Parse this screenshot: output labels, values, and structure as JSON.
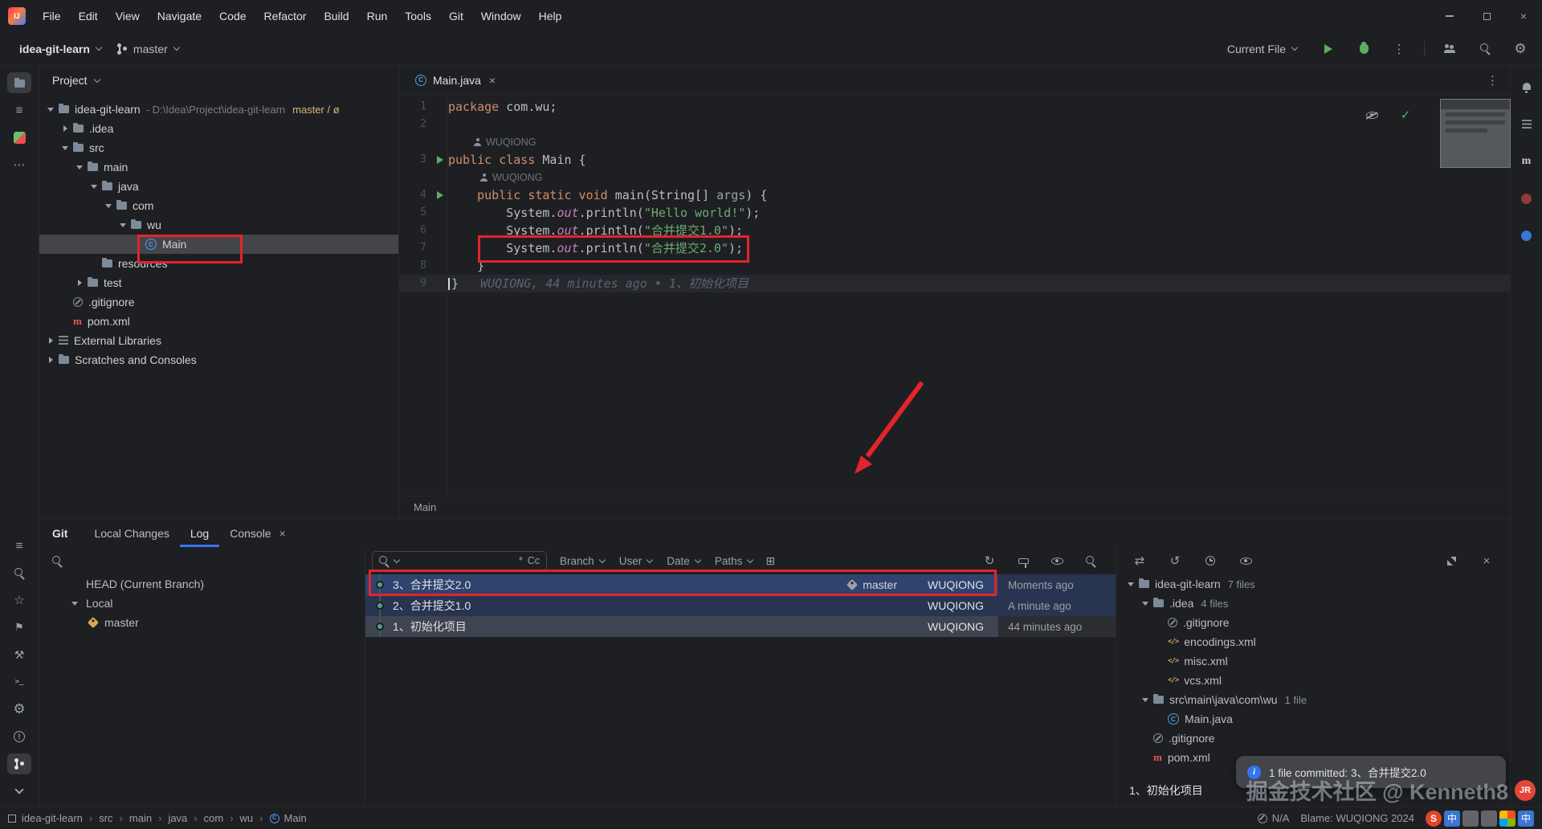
{
  "menu": {
    "items": [
      "File",
      "Edit",
      "View",
      "Navigate",
      "Code",
      "Refactor",
      "Build",
      "Run",
      "Tools",
      "Git",
      "Window",
      "Help"
    ]
  },
  "toolbar": {
    "project": "idea-git-learn",
    "branch": "master",
    "run_config": "Current File",
    "right_icons": [
      {
        "name": "run-button",
        "icon": "play"
      },
      {
        "name": "debug-button",
        "icon": "bug"
      },
      {
        "name": "more-actions-icon",
        "icon": "dotsv"
      },
      {
        "name": "toolbar-divider",
        "icon": "divider"
      },
      {
        "name": "code-with-me-icon",
        "icon": "users"
      },
      {
        "name": "search-everywhere-icon",
        "icon": "search"
      },
      {
        "name": "settings-icon",
        "icon": "gear"
      }
    ]
  },
  "left_strip": {
    "top": [
      {
        "name": "project-tool-icon",
        "icon": "folder",
        "active": true
      },
      {
        "name": "structure-tool-icon",
        "icon": "commit"
      },
      {
        "name": "plugin-tool-icon",
        "icon": "plugin"
      },
      {
        "name": "more-tool-windows-icon",
        "icon": "dotsh"
      }
    ],
    "bottom": [
      {
        "name": "commit-graph-icon",
        "icon": "commit"
      },
      {
        "name": "find-tool-icon",
        "icon": "search"
      },
      {
        "name": "favorites-icon",
        "icon": "star"
      },
      {
        "name": "bookmarks-icon",
        "icon": "flag"
      },
      {
        "name": "build-tool-icon",
        "icon": "build"
      },
      {
        "name": "terminal-tool-icon",
        "icon": "terminal"
      },
      {
        "name": "services-tool-icon",
        "icon": "gear"
      },
      {
        "name": "problems-tool-icon",
        "icon": "problems"
      },
      {
        "name": "git-tool-icon",
        "icon": "branch",
        "active": true
      },
      {
        "name": "hide-toolwindows-icon",
        "icon": "chevd"
      }
    ]
  },
  "right_strip": [
    {
      "name": "notifications-icon",
      "icon": "bell"
    },
    {
      "name": "database-icon",
      "icon": "lib"
    },
    {
      "name": "maven-tool-icon",
      "icon": "maven-m"
    },
    {
      "name": "profiler-icon",
      "icon": "reddot"
    },
    {
      "name": "dependencies-icon",
      "icon": "bluedot"
    }
  ],
  "project_panel": {
    "title": "Project",
    "tree": [
      {
        "label": "idea-git-learn",
        "suffix": "- D:\\Idea\\Project\\idea-git-learn",
        "decoration": "master / ø",
        "depth": 0,
        "icon": "folder",
        "arrow": "down"
      },
      {
        "label": ".idea",
        "depth": 1,
        "icon": "folder",
        "arrow": "right"
      },
      {
        "label": "src",
        "depth": 1,
        "icon": "folder",
        "arrow": "down"
      },
      {
        "label": "main",
        "depth": 2,
        "icon": "folder",
        "arrow": "down"
      },
      {
        "label": "java",
        "depth": 3,
        "icon": "folder",
        "arrow": "down"
      },
      {
        "label": "com",
        "depth": 4,
        "icon": "folder",
        "arrow": "down"
      },
      {
        "label": "wu",
        "depth": 5,
        "icon": "folder",
        "arrow": "down"
      },
      {
        "label": "Main",
        "depth": 6,
        "icon": "class",
        "selected": true
      },
      {
        "label": "resources",
        "depth": 3,
        "icon": "folder"
      },
      {
        "label": "test",
        "depth": 2,
        "icon": "folder",
        "arrow": "right"
      },
      {
        "label": ".gitignore",
        "depth": 1,
        "icon": "ignore"
      },
      {
        "label": "pom.xml",
        "depth": 1,
        "icon": "maven"
      },
      {
        "label": "External Libraries",
        "depth": 0,
        "icon": "lib",
        "arrow": "right"
      },
      {
        "label": "Scratches and Consoles",
        "depth": 0,
        "icon": "scratch",
        "arrow": "right"
      }
    ]
  },
  "editor": {
    "tab": {
      "label": "Main.java"
    },
    "inspection_icons": [
      {
        "name": "annotations-visibility-icon",
        "icon": "eyeoff"
      },
      {
        "name": "no-problems-icon",
        "icon": "check"
      }
    ],
    "rows": [
      {
        "num": "1",
        "tokens": [
          [
            "kw",
            "package "
          ],
          [
            "pl",
            "com.wu;"
          ]
        ]
      },
      {
        "num": "2",
        "tokens": []
      },
      {
        "ann": "WUQIONG",
        "indent": 32
      },
      {
        "num": "3",
        "run": true,
        "tokens": [
          [
            "kw",
            "public class "
          ],
          [
            "pl",
            "Main {"
          ]
        ]
      },
      {
        "ann": "WUQIONG",
        "indent": 40
      },
      {
        "num": "4",
        "run": true,
        "tokens": [
          [
            "pl",
            "    "
          ],
          [
            "kw",
            "public static void "
          ],
          [
            "pl",
            "main(String[] "
          ],
          [
            "dim",
            "args"
          ],
          [
            "pl",
            ") {"
          ]
        ]
      },
      {
        "num": "5",
        "tokens": [
          [
            "pl",
            "        System."
          ],
          [
            "fld",
            "out"
          ],
          [
            "pl",
            ".println("
          ],
          [
            "str",
            "\"Hello world!\""
          ],
          [
            "pl",
            ");"
          ]
        ]
      },
      {
        "num": "6",
        "tokens": [
          [
            "pl",
            "        System."
          ],
          [
            "fld",
            "out"
          ],
          [
            "pl",
            ".println("
          ],
          [
            "str",
            "\"合并提交1.0\""
          ],
          [
            "pl",
            ");"
          ]
        ]
      },
      {
        "num": "7",
        "tokens": [
          [
            "pl",
            "        System."
          ],
          [
            "fld",
            "out"
          ],
          [
            "pl",
            ".println("
          ],
          [
            "str",
            "\"合并提交2.0\""
          ],
          [
            "pl",
            ");"
          ]
        ]
      },
      {
        "num": "8",
        "tokens": [
          [
            "pl",
            "    }"
          ]
        ]
      },
      {
        "num": "9",
        "caret": true,
        "tokens": [
          [
            "pl",
            "}"
          ],
          [
            "blame",
            "   WUQIONG, 44 minutes ago • 1、初始化项目"
          ]
        ]
      }
    ],
    "breadcrumb": "Main"
  },
  "git_panel": {
    "title": "Git",
    "tabs": [
      {
        "label": "Local Changes"
      },
      {
        "label": "Log",
        "active": true
      },
      {
        "label": "Console",
        "closable": true
      }
    ],
    "branches": {
      "head_label": "HEAD (Current Branch)",
      "group_label": "Local",
      "items": [
        {
          "label": "master"
        }
      ]
    },
    "log": {
      "toggles": [
        "*",
        "Cc"
      ],
      "filters": [
        "Branch",
        "User",
        "Date",
        "Paths"
      ],
      "toolbar_icons": [
        {
          "name": "refresh-icon",
          "icon": "refresh"
        },
        {
          "name": "highlight-icon",
          "icon": "paint"
        },
        {
          "name": "preview-icon",
          "icon": "eye"
        },
        {
          "name": "find-icon",
          "icon": "search"
        }
      ],
      "commits": [
        {
          "message": "3、合并提交2.0",
          "ref": "master",
          "author": "WUQIONG",
          "time": "Moments ago",
          "selected": true
        },
        {
          "message": "2、合并提交1.0",
          "author": "WUQIONG",
          "time": "A minute ago",
          "style": "navy"
        },
        {
          "message": "1、初始化项目",
          "author": "WUQIONG",
          "time": "44 minutes ago",
          "style": "slate"
        }
      ]
    },
    "details": {
      "toolbar_icons": [
        {
          "name": "compare-icon",
          "icon": "compare"
        },
        {
          "name": "rollback-icon",
          "icon": "undo"
        },
        {
          "name": "history-icon",
          "icon": "clock"
        },
        {
          "name": "preview-diff-icon",
          "icon": "eye"
        }
      ],
      "window_icons": [
        {
          "name": "expand-icon",
          "icon": "expand"
        },
        {
          "name": "hide-icon",
          "icon": "close"
        }
      ],
      "tree": [
        {
          "label": "idea-git-learn",
          "count": "7 files",
          "depth": 0,
          "icon": "folder",
          "arrow": "down"
        },
        {
          "label": ".idea",
          "count": "4 files",
          "depth": 1,
          "icon": "folder",
          "arrow": "down"
        },
        {
          "label": ".gitignore",
          "depth": 2,
          "icon": "ignore"
        },
        {
          "label": "encodings.xml",
          "depth": 2,
          "icon": "xml"
        },
        {
          "label": "misc.xml",
          "depth": 2,
          "icon": "xml"
        },
        {
          "label": "vcs.xml",
          "depth": 2,
          "icon": "xml"
        },
        {
          "label": "src\\main\\java\\com\\wu",
          "count": "1 file",
          "depth": 1,
          "icon": "folder",
          "arrow": "down"
        },
        {
          "label": "Main.java",
          "depth": 2,
          "icon": "class"
        },
        {
          "label": ".gitignore",
          "depth": 1,
          "icon": "ignore"
        },
        {
          "label": "pom.xml",
          "depth": 1,
          "icon": "maven"
        }
      ],
      "commit_message": "1、初始化项目"
    },
    "notification": {
      "text": "1 file committed: 3、合并提交2.0"
    }
  },
  "status_bar": {
    "breadcrumbs": [
      "idea-git-learn",
      "src",
      "main",
      "java",
      "com",
      "wu",
      "Main"
    ],
    "na": "N/A",
    "blame": "Blame: WUQIONG 2024",
    "ime": [
      {
        "name": "sogou-input-icon",
        "label": "S",
        "bg": "#e0452c",
        "round": true
      },
      {
        "name": "ime-language-icon",
        "label": "中",
        "bg": "#3a76d2"
      },
      {
        "name": "voice-input-icon",
        "label": "",
        "bg": "#63656a"
      },
      {
        "name": "handwriting-icon",
        "label": "",
        "bg": "#63656a"
      },
      {
        "name": "ms-grid-icon",
        "label": "",
        "bg": "grid"
      },
      {
        "name": "keyboard-icon",
        "label": "中",
        "bg": "#3a76d2"
      }
    ]
  },
  "watermark": {
    "text": "掘金技术社区 @ Kenneth8"
  },
  "colors": {
    "accent": "#3574f0",
    "selection_blue": "#2e436e",
    "annotation_red": "#e3242b",
    "run_green": "#5fad65",
    "keyword_orange": "#cf8e6d",
    "string_green": "#6aab73"
  }
}
